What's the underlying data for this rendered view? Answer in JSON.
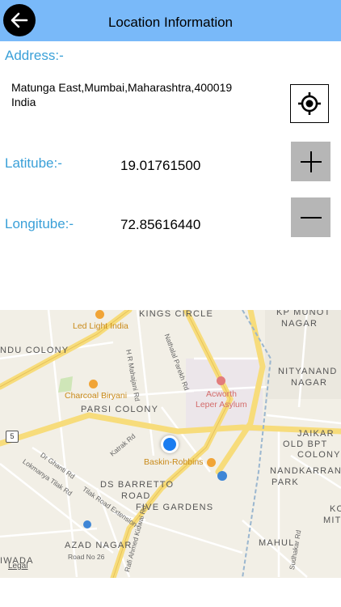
{
  "header": {
    "title": "Location Information",
    "back_icon": "arrow-left-icon"
  },
  "address": {
    "label": "Address:-",
    "value_line1": "Matunga East,Mumbai,Maharashtra,400019",
    "value_line2": "India"
  },
  "latitude": {
    "label": "Latitube:-",
    "value": "19.01761500"
  },
  "longitude": {
    "label": "Longitube:-",
    "value": "72.85616440"
  },
  "controls": {
    "locate_icon": "crosshair-icon",
    "zoom_in_icon": "plus-icon",
    "zoom_out_icon": "minus-icon"
  },
  "map": {
    "areas": [
      "KINGS CIRCLE",
      "KP MUNOT",
      "NAGAR",
      "NDU COLONY",
      "NITYANAND",
      "NAGAR",
      "PARSI COLONY",
      "JAIKAR",
      "OLD BPT",
      "COLONY",
      "DS BARRETTO",
      "ROAD",
      "NANDKARRANI",
      "PARK",
      "FIVE GARDENS",
      "AZAD NAGAR",
      "MAHUL",
      "IWADA",
      "KO",
      "MIT"
    ],
    "pois": [
      "Led Light India",
      "Charcoal Biryani",
      "Acworth",
      "Leper Asylum",
      "Baskin-Robbins"
    ],
    "roads": [
      "H R Mahajani Rd",
      "Nathalal Parekh Rd",
      "Katrak Rd",
      "Dr Ghanti Rd",
      "Lokmanya Tilak Rd",
      "Tilak Road Extension",
      "Road No 26",
      "Rafi Ahmed Kidwai Rd",
      "Sudhakar Rd"
    ],
    "route_shield": "5",
    "legal": "Legal"
  }
}
